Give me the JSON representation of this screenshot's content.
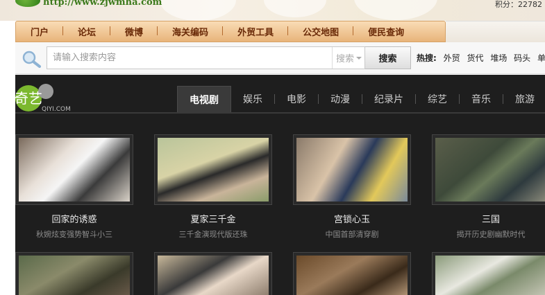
{
  "header": {
    "site_url": "http://www.zjwmha.com",
    "points_label": "积分：22782"
  },
  "nav": {
    "items": [
      "门户",
      "论坛",
      "微博",
      "海关编码",
      "外贸工具",
      "公交地图",
      "便民查询"
    ]
  },
  "search": {
    "placeholder": "请输入搜索内容",
    "type_label": "搜索",
    "button_label": "搜索",
    "hot_label": "热搜:",
    "hot_terms": [
      "外贸",
      "货代",
      "堆场",
      "码头",
      "单证"
    ]
  },
  "video": {
    "logo_text": "奇艺",
    "logo_sub": "QIYI.COM",
    "tabs": [
      "电视剧",
      "娱乐",
      "电影",
      "动漫",
      "纪录片",
      "综艺",
      "音乐",
      "旅游"
    ],
    "active_tab": "电视剧",
    "cards": [
      {
        "title": "回家的诱惑",
        "subtitle": "秋婉炫变强势智斗小三"
      },
      {
        "title": "夏家三千金",
        "subtitle": "三千金演现代版还珠"
      },
      {
        "title": "宫锁心玉",
        "subtitle": "中国首部清穿剧"
      },
      {
        "title": "三国",
        "subtitle": "揭开历史剧幽默时代"
      }
    ]
  },
  "colors": {
    "nav_gradient_top": "#f9dcb6",
    "nav_text": "#6a2a08",
    "panel_bg": "#1e1e1e",
    "logo_green": "#7cb82f"
  }
}
